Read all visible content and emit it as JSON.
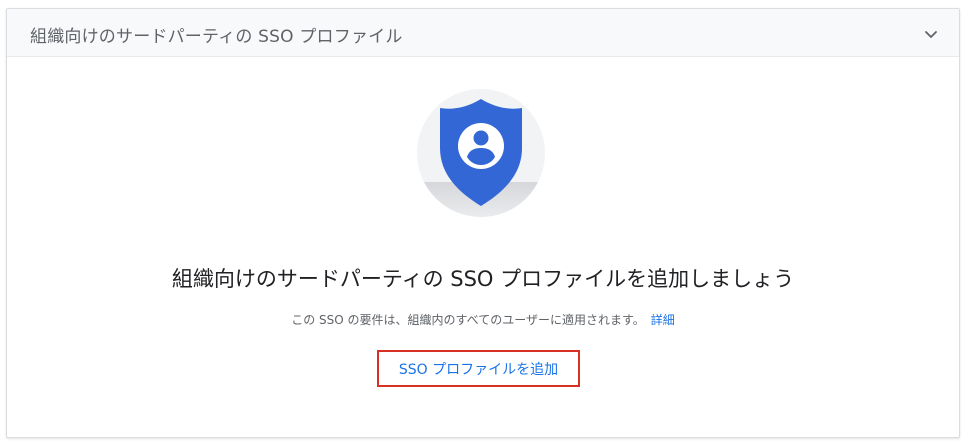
{
  "panel": {
    "title": "組織向けのサードパーティの SSO プロファイル"
  },
  "empty_state": {
    "headline": "組織向けのサードパーティの SSO プロファイルを追加しましょう",
    "description": "この SSO の要件は、組織内のすべてのユーザーに適用されます。",
    "learn_more": "詳細",
    "add_button": "SSO プロファイルを追加"
  },
  "colors": {
    "shield": "#3367d6",
    "link": "#1a73e8",
    "highlight_border": "#d93025"
  },
  "icons": {
    "expand": "chevron-down-icon",
    "illustration": "shield-user-icon"
  }
}
